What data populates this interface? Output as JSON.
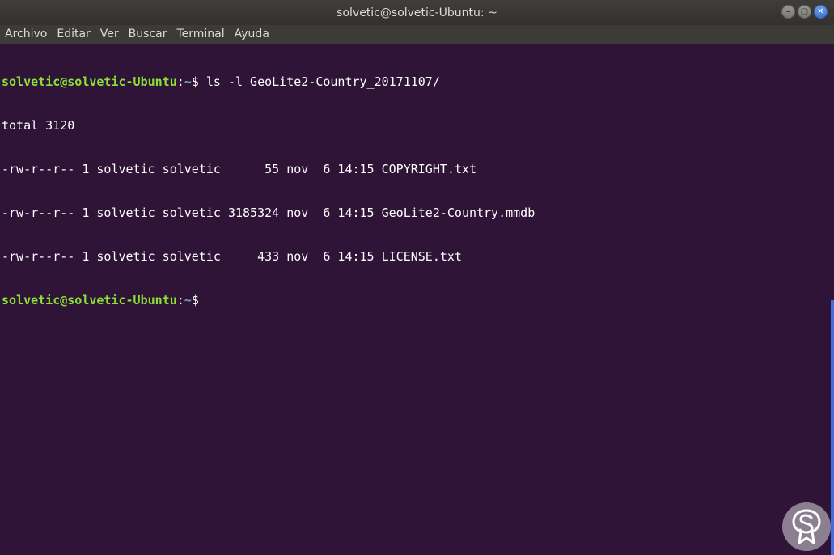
{
  "window": {
    "title": "solvetic@solvetic-Ubuntu: ~",
    "controls": {
      "minimize_icon": "minimize-icon",
      "maximize_icon": "maximize-icon",
      "close_icon": "close-icon",
      "minimize_glyph": "–",
      "maximize_glyph": "▢",
      "close_glyph": "✕"
    }
  },
  "menu": {
    "items": [
      "Archivo",
      "Editar",
      "Ver",
      "Buscar",
      "Terminal",
      "Ayuda"
    ]
  },
  "terminal": {
    "prompt_user": "solvetic@solvetic-Ubuntu",
    "prompt_colon": ":",
    "prompt_path": "~",
    "prompt_symbol": "$ ",
    "command": "ls -l GeoLite2-Country_20171107/",
    "output": [
      "total 3120",
      "-rw-r--r-- 1 solvetic solvetic      55 nov  6 14:15 COPYRIGHT.txt",
      "-rw-r--r-- 1 solvetic solvetic 3185324 nov  6 14:15 GeoLite2-Country.mmdb",
      "-rw-r--r-- 1 solvetic solvetic     433 nov  6 14:15 LICENSE.txt"
    ],
    "final_prompt_symbol": "$"
  },
  "colors": {
    "terminal_bg": "#2f1437",
    "prompt_user": "#8ae234",
    "prompt_path": "#729fcf",
    "scrollbar": "#3f6ee0"
  },
  "watermark": {
    "icon": "solvetic-logo-icon"
  }
}
